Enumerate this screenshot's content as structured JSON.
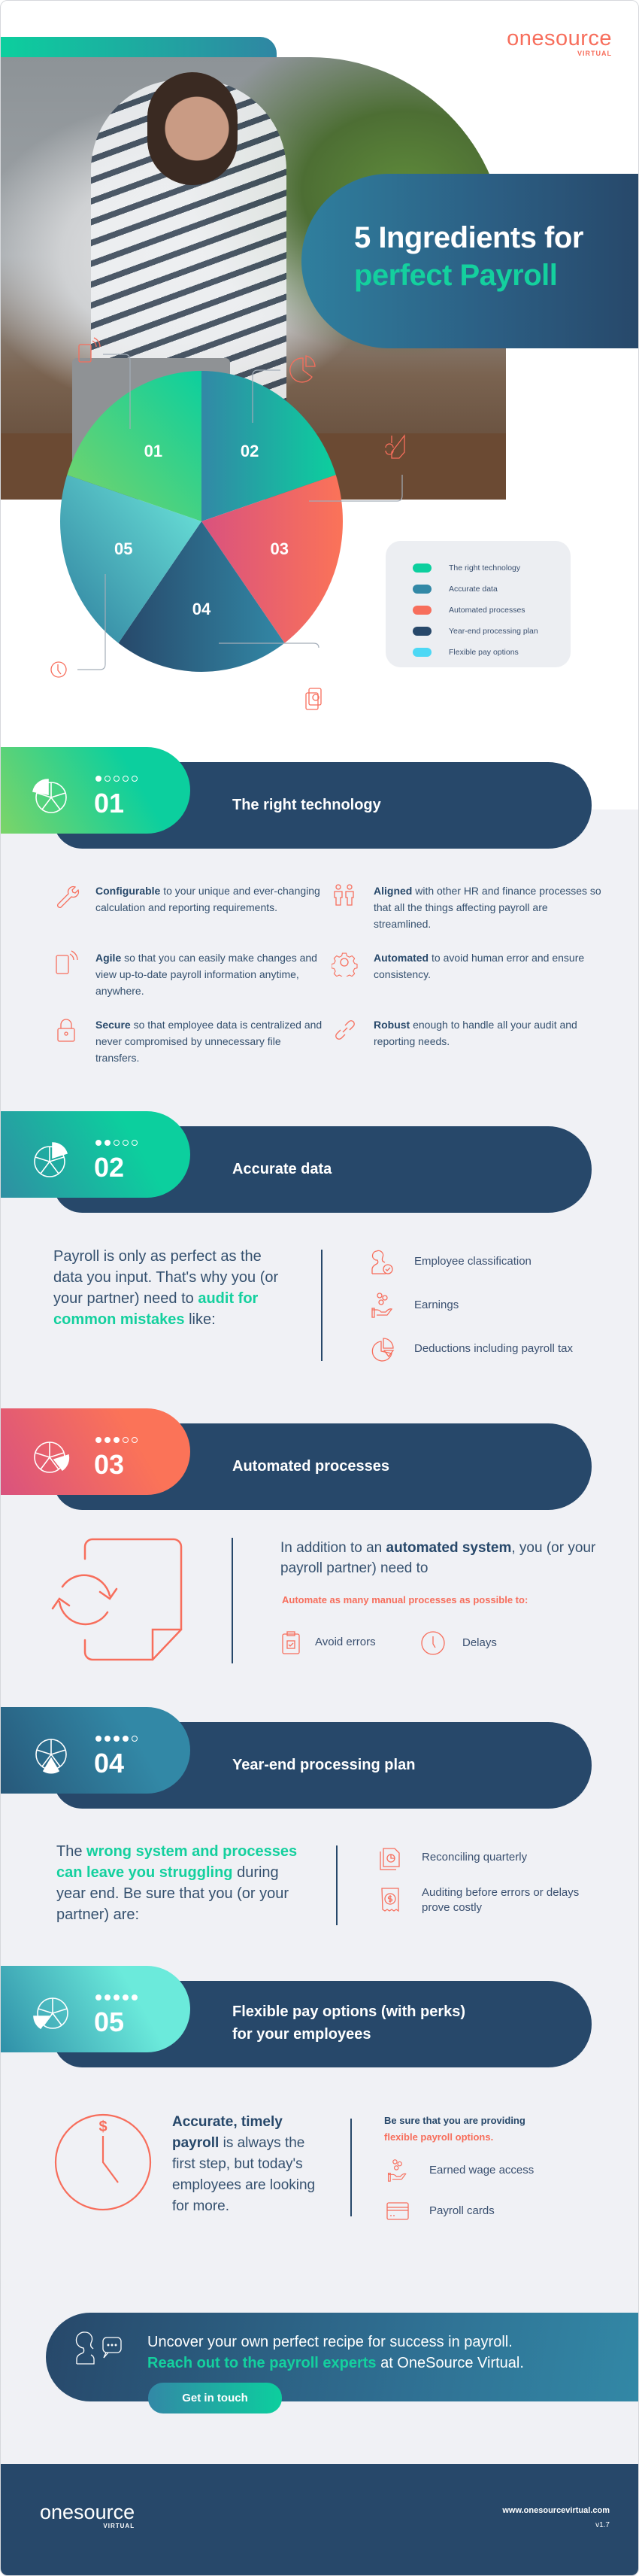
{
  "brand": {
    "name": "onesource",
    "sub": "VIRTUAL",
    "color_primary": "#27486a",
    "color_accent": "#14d09e",
    "color_coral": "#f76e5c"
  },
  "hero": {
    "title_line1": "5 Ingredients for",
    "title_line2": "perfect Payroll",
    "photo": "woman-reviewing-payroll-at-desk"
  },
  "chart_data": {
    "type": "pie",
    "title": "5 Ingredients for perfect Payroll",
    "categories": [
      "01",
      "02",
      "03",
      "04",
      "05"
    ],
    "values": [
      20,
      20,
      20,
      20,
      20
    ],
    "legend_position": "right",
    "legend": [
      {
        "label": "The right technology",
        "color": "#0ccf9e"
      },
      {
        "label": "Accurate data",
        "color": "#3288a6"
      },
      {
        "label": "Automated processes",
        "color": "#f76e5c"
      },
      {
        "label": "Year-end processing plan",
        "color": "#27486a"
      },
      {
        "label": "Flexible pay options",
        "color": "#4dd8f5"
      }
    ],
    "callout_icons": [
      "mobile-icon",
      "pie-chart-icon",
      "document-refresh-icon",
      "documents-clock-icon",
      "clock-icon"
    ]
  },
  "sections": [
    {
      "number": "01",
      "title": "The right technology",
      "filled_dots": 1,
      "features": [
        {
          "icon": "wrench-icon",
          "bold": "Configurable",
          "text": " to your unique and ever-changing calculation and reporting requirements."
        },
        {
          "icon": "mobile-icon",
          "bold": "Agile",
          "text": " so that you can easily make changes and view up-to-date payroll information anytime, anywhere."
        },
        {
          "icon": "lock-icon",
          "bold": "Secure",
          "text": " so that employee data is centralized and never compromised by unnecessary file transfers."
        },
        {
          "icon": "people-icon",
          "bold": "Aligned",
          "text": " with other HR and finance processes so that all the things affecting payroll are streamlined."
        },
        {
          "icon": "gear-icon",
          "bold": "Automated",
          "text": " to avoid human error and ensure consistency."
        },
        {
          "icon": "link-icon",
          "bold": "Robust",
          "text": " enough to handle all your audit and reporting needs."
        }
      ]
    },
    {
      "number": "02",
      "title": "Accurate data",
      "filled_dots": 2,
      "lead_pre": "Payroll is only as perfect as the data you input. That's why you (or your partner) need to ",
      "lead_highlight": "audit for common mistakes",
      "lead_post": " like:",
      "items": [
        {
          "icon": "employee-check-icon",
          "label": "Employee classification"
        },
        {
          "icon": "coins-hand-icon",
          "label": "Earnings"
        },
        {
          "icon": "pie-chart-icon",
          "label": "Deductions including payroll tax"
        }
      ]
    },
    {
      "number": "03",
      "title": "Automated processes",
      "filled_dots": 3,
      "lead_pre": "In addition to an ",
      "lead_bold": "automated system",
      "lead_post": ", you (or your payroll partner) need to",
      "subhead": "Automate as many manual processes as possible to:",
      "items": [
        {
          "icon": "clipboard-check-icon",
          "label": "Avoid errors"
        },
        {
          "icon": "clock-icon",
          "label": "Delays"
        }
      ]
    },
    {
      "number": "04",
      "title": "Year-end processing plan",
      "filled_dots": 4,
      "lead_pre": "The ",
      "lead_highlight": "wrong system and processes can leave you struggling",
      "lead_post": " during year end. Be sure that you (or your partner) are:",
      "items": [
        {
          "icon": "documents-clock-icon",
          "label": "Reconciling quarterly"
        },
        {
          "icon": "receipt-dollar-icon",
          "label": "Auditing before errors or delays prove costly"
        }
      ]
    },
    {
      "number": "05",
      "title_line1": "Flexible pay options (with perks)",
      "title_line2": "for your employees",
      "filled_dots": 5,
      "lead_bold": "Accurate, timely payroll",
      "lead_post": " is always the first step, but today's employees are looking for more.",
      "subhead_pre": "Be sure that you are providing",
      "subhead_highlight": "flexible payroll options.",
      "items": [
        {
          "icon": "coins-hand-icon",
          "label": "Earned wage access"
        },
        {
          "icon": "card-icon",
          "label": "Payroll cards"
        }
      ]
    }
  ],
  "cta": {
    "line1": "Uncover your own perfect recipe for success in payroll.",
    "highlight": "Reach out to the payroll experts",
    "line2_post": " at OneSource Virtual.",
    "button": "Get in touch"
  },
  "footer": {
    "url": "www.onesourcevirtual.com",
    "version": "v1.7"
  }
}
